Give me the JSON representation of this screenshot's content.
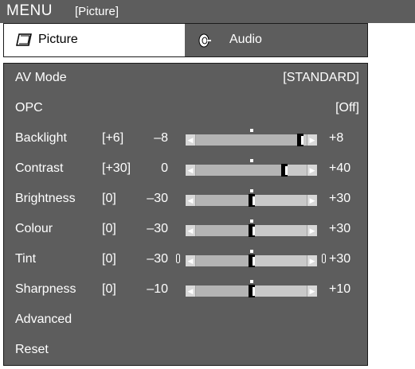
{
  "titlebar": {
    "menu": "MENU",
    "section": "[Picture]"
  },
  "tabs": [
    {
      "label": "Picture",
      "icon": "display-icon",
      "active": true
    },
    {
      "label": "Audio",
      "icon": "speaker-icon",
      "active": false
    }
  ],
  "rows": [
    {
      "label": "AV Mode",
      "value": "[STANDARD]"
    },
    {
      "label": "OPC",
      "value": "[Off]"
    },
    {
      "label": "Backlight",
      "current": "[+6]",
      "min": "–8",
      "max": "+8",
      "level": 0.875
    },
    {
      "label": "Contrast",
      "current": "[+30]",
      "min": "0",
      "max": "+40",
      "level": 0.75
    },
    {
      "label": "Brightness",
      "current": "[0]",
      "min": "–30",
      "max": "+30",
      "level": 0.5
    },
    {
      "label": "Colour",
      "current": "[0]",
      "min": "–30",
      "max": "+30",
      "level": 0.5
    },
    {
      "label": "Tint",
      "current": "[0]",
      "min": "–30",
      "max": "+30",
      "level": 0.5
    },
    {
      "label": "Sharpness",
      "current": "[0]",
      "min": "–10",
      "max": "+10",
      "level": 0.5
    },
    {
      "label": "Advanced"
    },
    {
      "label": "Reset"
    }
  ]
}
